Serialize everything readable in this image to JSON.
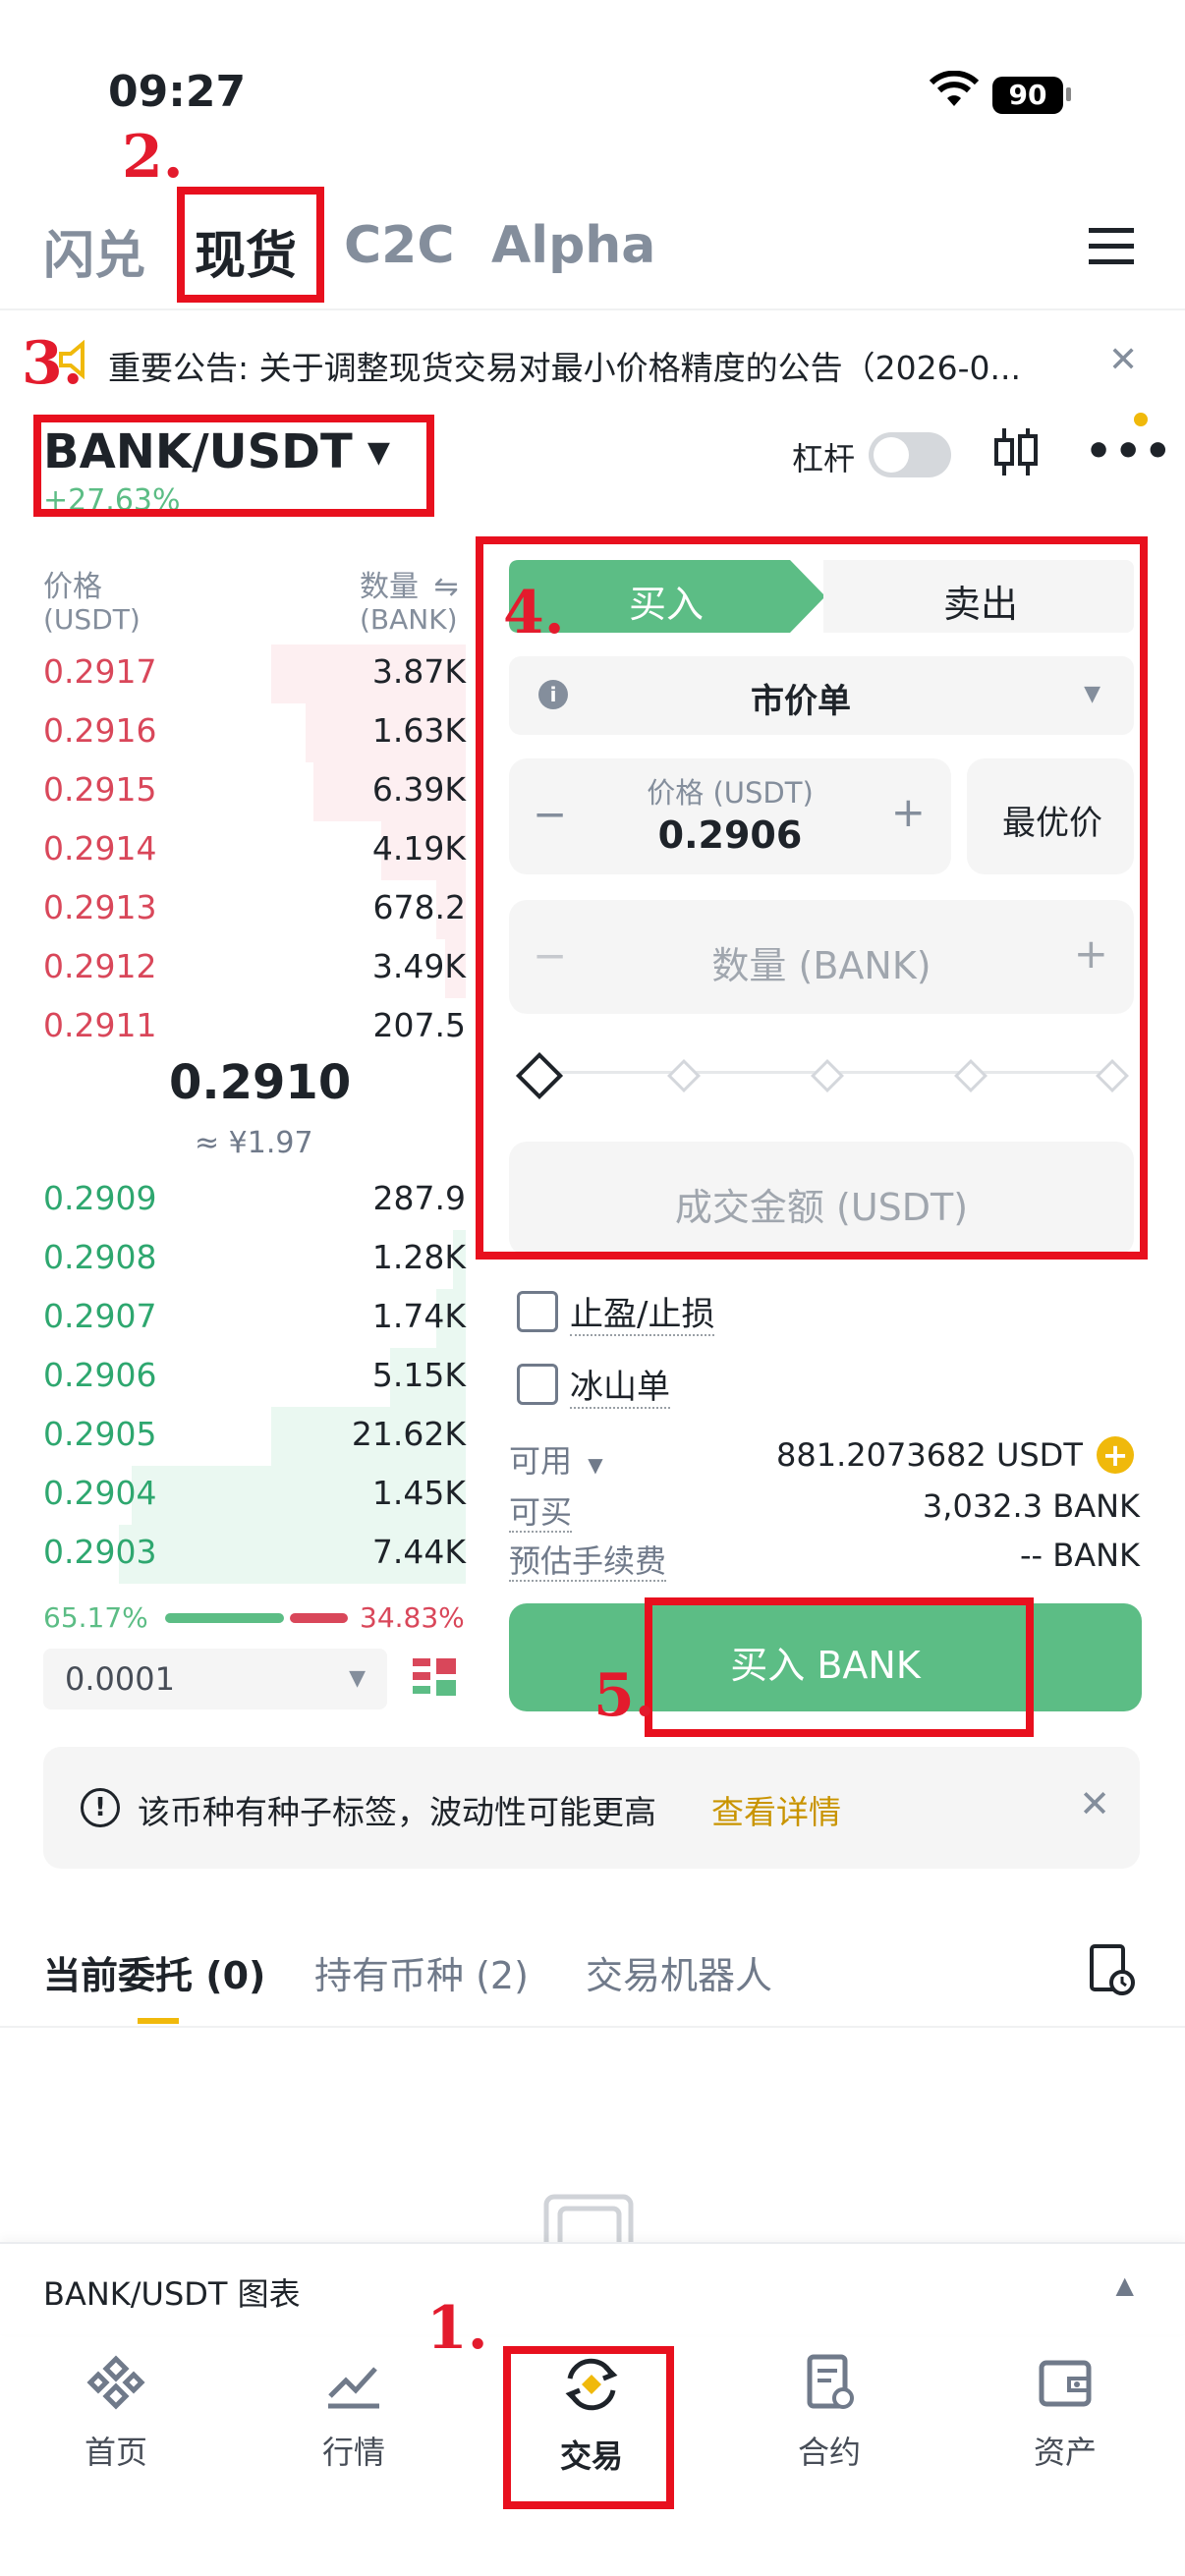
{
  "status_bar": {
    "time": "09:27",
    "battery": "90"
  },
  "tabs": [
    {
      "label": "闪兑",
      "active": false
    },
    {
      "label": "现货",
      "active": true
    },
    {
      "label": "C2C",
      "active": false
    },
    {
      "label": "Alpha",
      "active": false
    }
  ],
  "announcement": {
    "text": "重要公告: 关于调整现货交易对最小价格精度的公告（2026-0..."
  },
  "pair": {
    "symbol": "BANK/USDT",
    "change": "+27.63%",
    "leverage_label": "杠杆"
  },
  "orderbook": {
    "price_header": "价格",
    "price_unit": "(USDT)",
    "qty_header": "数量",
    "qty_unit": "(BANK)",
    "asks": [
      {
        "price": "0.2917",
        "qty": "3.87K",
        "depth": 0.46
      },
      {
        "price": "0.2916",
        "qty": "1.63K",
        "depth": 0.38
      },
      {
        "price": "0.2915",
        "qty": "6.39K",
        "depth": 0.36
      },
      {
        "price": "0.2914",
        "qty": "4.19K",
        "depth": 0.2
      },
      {
        "price": "0.2913",
        "qty": "678.2",
        "depth": 0.07
      },
      {
        "price": "0.2912",
        "qty": "3.49K",
        "depth": 0.05
      },
      {
        "price": "0.2911",
        "qty": "207.5",
        "depth": 0.0
      }
    ],
    "last_price": "0.2910",
    "last_price_cny": "≈ ¥1.97",
    "bids": [
      {
        "price": "0.2909",
        "qty": "287.9",
        "depth": 0.0
      },
      {
        "price": "0.2908",
        "qty": "1.28K",
        "depth": 0.03
      },
      {
        "price": "0.2907",
        "qty": "1.74K",
        "depth": 0.07
      },
      {
        "price": "0.2906",
        "qty": "5.15K",
        "depth": 0.18
      },
      {
        "price": "0.2905",
        "qty": "21.62K",
        "depth": 0.46
      },
      {
        "price": "0.2904",
        "qty": "1.45K",
        "depth": 0.79
      },
      {
        "price": "0.2903",
        "qty": "7.44K",
        "depth": 0.82
      }
    ],
    "buy_ratio": "65.17%",
    "sell_ratio": "34.83%",
    "buy_ratio_value": 0.6517,
    "precision": "0.0001"
  },
  "order_form": {
    "buy_tab": "买入",
    "sell_tab": "卖出",
    "order_type": "市价单",
    "price_label": "价格 (USDT)",
    "price_value": "0.2906",
    "best_price": "最优价",
    "qty_placeholder": "数量 (BANK)",
    "amount_placeholder": "成交金额 (USDT)",
    "take_profit_label": "止盈/止损",
    "iceberg_label": "冰山单",
    "available_label": "可用",
    "available_value": "881.2073682 USDT",
    "can_buy_label": "可买",
    "can_buy_value": "3,032.3 BANK",
    "fee_label": "预估手续费",
    "fee_value": "-- BANK",
    "submit_label": "买入 BANK"
  },
  "notice": {
    "text": "该币种有种子标签，波动性可能更高",
    "link": "查看详情"
  },
  "bottom_tabs": [
    {
      "label": "当前委托 (0)",
      "active": true
    },
    {
      "label": "持有币种 (2)",
      "active": false
    },
    {
      "label": "交易机器人",
      "active": false
    }
  ],
  "chart_bar": {
    "label": "BANK/USDT 图表"
  },
  "nav": [
    {
      "label": "首页",
      "icon": "home-icon"
    },
    {
      "label": "行情",
      "icon": "markets-icon"
    },
    {
      "label": "交易",
      "icon": "trade-icon"
    },
    {
      "label": "合约",
      "icon": "futures-icon"
    },
    {
      "label": "资产",
      "icon": "wallet-icon"
    }
  ],
  "annotations": [
    "1.",
    "2.",
    "3.",
    "4.",
    "5."
  ],
  "colors": {
    "buy": "#5cbd85",
    "sell": "#d9475a",
    "accent": "#f0b90b",
    "annotation": "#e8101e"
  }
}
